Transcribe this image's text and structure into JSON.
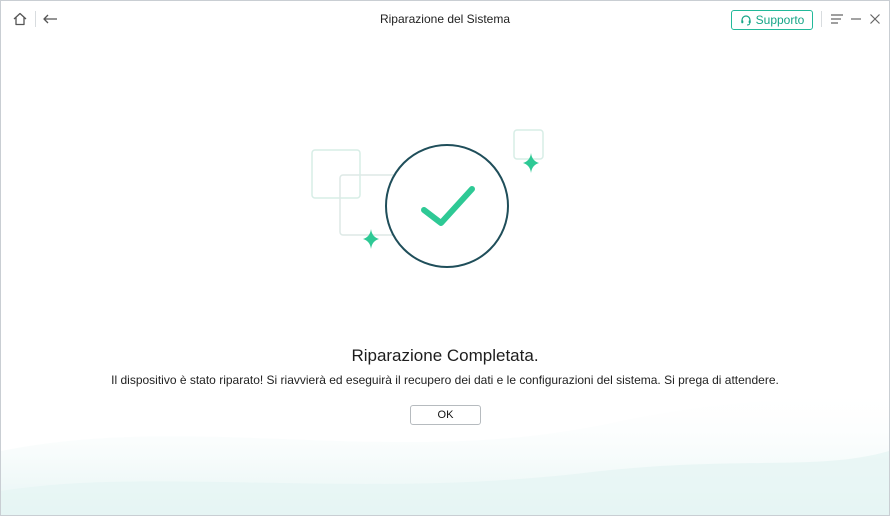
{
  "window": {
    "title": "Riparazione del Sistema"
  },
  "toolbar": {
    "home_icon": "home-icon",
    "back_icon": "back-arrow-icon",
    "support_label": "Supporto",
    "support_icon": "headset-icon",
    "menu_icon": "menu-icon",
    "minimize_icon": "minimize-icon",
    "close_icon": "close-icon"
  },
  "result": {
    "icon": "checkmark-circle-icon",
    "heading": "Riparazione Completata.",
    "message": "Il dispositivo è stato riparato! Si riavvierà ed eseguirà il recupero dei dati e le configurazioni del sistema. Si prega di attendere.",
    "ok_label": "OK"
  },
  "colors": {
    "accent": "#22b99a",
    "check": "#2ec995",
    "circle_border": "#1f4e5a",
    "frame": "#d6ece6"
  }
}
